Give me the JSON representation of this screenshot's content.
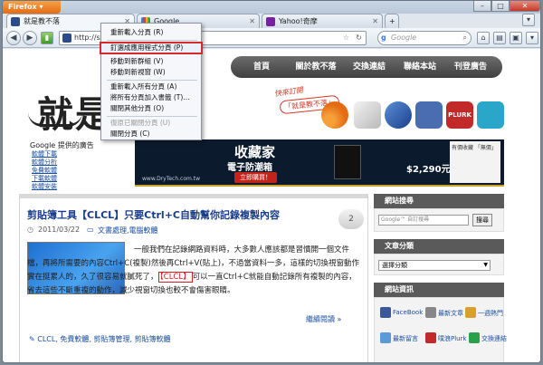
{
  "browser": {
    "app_button": "Firefox",
    "tabs": [
      {
        "label": "就是教不落",
        "active": true
      },
      {
        "label": "Google",
        "active": false
      },
      {
        "label": "Yahoo!奇摩",
        "active": false
      }
    ],
    "url": "http://ste",
    "search_placeholder": "Google"
  },
  "context_menu": {
    "items": [
      {
        "label": "重新載入分頁 (R)",
        "disabled": false,
        "highlight": false
      },
      {
        "label": "釘選成應用程式分頁 (P)",
        "disabled": false,
        "highlight": true
      },
      {
        "label": "移動到新群組 (V)",
        "disabled": false,
        "highlight": false
      },
      {
        "label": "移動到新視窗 (W)",
        "disabled": false,
        "highlight": false
      },
      {
        "label": "重新載入所有分頁 (A)",
        "disabled": false,
        "highlight": false
      },
      {
        "label": "將所有分頁加入書籤 (T)...",
        "disabled": false,
        "highlight": false
      },
      {
        "label": "關閉其他分頁 (O)",
        "disabled": false,
        "highlight": false
      },
      {
        "label": "復原已關閉分頁 (U)",
        "disabled": true,
        "highlight": false
      },
      {
        "label": "關閉分頁 (C)",
        "disabled": false,
        "highlight": false
      }
    ]
  },
  "site": {
    "nav": [
      "首頁",
      "關於教不落",
      "交換連結",
      "聯絡本站",
      "刊登廣告"
    ],
    "logo": "就是教",
    "stamp_top": "快來訂閱",
    "stamp_bottom": "「就是教不落」",
    "ads_title": "Google 提供的廣告",
    "ads_links": [
      "軟體下載",
      "軟體分析",
      "免費軟體",
      "下載軟體",
      "軟體安裝"
    ],
    "banner": {
      "title": "收藏家",
      "subtitle": "電子防潮箱",
      "buy": "立即購買！",
      "url": "www.DryTech.com.tw",
      "price": "$2,290元",
      "right_text": "有價收藏 「無價」"
    }
  },
  "post": {
    "title": "剪貼簿工具【CLCL】只要Ctrl+C自動幫你記錄複製內容",
    "date": "2011/03/22",
    "category": "文書處理,電腦軟體",
    "comments": "2",
    "body_1": "一般我們在記錄網路資料時，大多數人應該都是習慣開一個文件檔，再將所需要的內容Ctrl+C(複製)然後再Ctrl+V(貼上)，不過當資料一多，這樣的切換視窗動作實在挺累人的，久了很容易就膩死了，",
    "body_red": "【CLCL】",
    "body_2": "可以一直Ctrl+C就能自動記錄所有複製的內容，省去這些不斷重複的動作，減少視窗切換也較不會傷害眼睛。",
    "more": "繼續閱讀 »",
    "tags": "CLCL, 免費軟體, 剪貼簿管理, 剪貼簿軟體"
  },
  "sidebar": {
    "search_head": "網站搜尋",
    "search_placeholder": "Google™ 自訂搜尋",
    "search_button": "搜尋",
    "category_head": "文章分類",
    "category_select": "選擇分類",
    "info_head": "網站資訊",
    "links": [
      "FaceBook",
      "最新文章",
      "一週熱門",
      "最新留言",
      "噗浪Plurk",
      "交換連結"
    ]
  },
  "colors": {
    "menu_highlight": "#d62a2a",
    "title_blue": "#1a3d8a",
    "firefox_orange": "#e46b12"
  }
}
